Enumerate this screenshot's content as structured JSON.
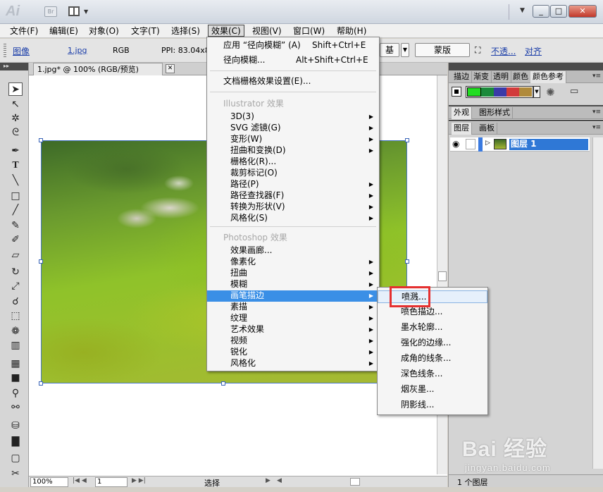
{
  "app": {
    "logo": "Ai",
    "bridge": "Br"
  },
  "window": {
    "min": "_",
    "max": "□",
    "close": "✕"
  },
  "menubar": [
    {
      "label": "文件(F)"
    },
    {
      "label": "编辑(E)"
    },
    {
      "label": "对象(O)"
    },
    {
      "label": "文字(T)"
    },
    {
      "label": "选择(S)"
    },
    {
      "label": "效果(C)"
    },
    {
      "label": "视图(V)"
    },
    {
      "label": "窗口(W)"
    },
    {
      "label": "帮助(H)"
    }
  ],
  "controlbar": {
    "image_label": "图像",
    "file_link": "1.jpg",
    "color_mode": "RGB",
    "ppi": "PPI: 83.04x84.",
    "partial_button": "基",
    "mask_button": "蒙版",
    "opacity_link": "不透...",
    "align_link": "对齐"
  },
  "document": {
    "tab_title": "1.jpg* @ 100% (RGB/预览)",
    "tab_close": "✕"
  },
  "statusbar": {
    "zoom": "100%",
    "page": "1",
    "tool": "选择"
  },
  "effects_menu": {
    "apply_last": {
      "label": "应用 “径向模糊” (A)",
      "shortcut": "Shift+Ctrl+E"
    },
    "last_effect": {
      "label": "径向模糊...",
      "shortcut": "Alt+Shift+Ctrl+E"
    },
    "raster_settings": "文档栅格效果设置(E)...",
    "illustrator_header": "Illustrator 效果",
    "illustrator_items": [
      {
        "label": "3D(3)",
        "sub": true
      },
      {
        "label": "SVG 滤镜(G)",
        "sub": true
      },
      {
        "label": "变形(W)",
        "sub": true
      },
      {
        "label": "扭曲和变换(D)",
        "sub": true
      },
      {
        "label": "栅格化(R)...",
        "sub": false
      },
      {
        "label": "裁剪标记(O)",
        "sub": false
      },
      {
        "label": "路径(P)",
        "sub": true
      },
      {
        "label": "路径查找器(F)",
        "sub": true
      },
      {
        "label": "转换为形状(V)",
        "sub": true
      },
      {
        "label": "风格化(S)",
        "sub": true
      }
    ],
    "photoshop_header": "Photoshop 效果",
    "photoshop_items": [
      {
        "label": "效果画廊...",
        "sub": false
      },
      {
        "label": "像素化",
        "sub": true
      },
      {
        "label": "扭曲",
        "sub": true
      },
      {
        "label": "模糊",
        "sub": true
      },
      {
        "label": "画笔描边",
        "sub": true
      },
      {
        "label": "素描",
        "sub": true
      },
      {
        "label": "纹理",
        "sub": true
      },
      {
        "label": "艺术效果",
        "sub": true
      },
      {
        "label": "视频",
        "sub": true
      },
      {
        "label": "锐化",
        "sub": true
      },
      {
        "label": "风格化",
        "sub": true
      }
    ]
  },
  "brush_submenu": [
    {
      "label": "喷溅..."
    },
    {
      "label": "喷色描边..."
    },
    {
      "label": "墨水轮廓..."
    },
    {
      "label": "强化的边缘..."
    },
    {
      "label": "成角的线条..."
    },
    {
      "label": "深色线条..."
    },
    {
      "label": "烟灰墨..."
    },
    {
      "label": "阴影线..."
    }
  ],
  "panels": {
    "top_tabs": [
      "描边",
      "渐变",
      "透明",
      "颜色",
      "颜色参考"
    ],
    "appearance_tabs": [
      "外观",
      "图形样式"
    ],
    "layers_tabs": [
      "图层",
      "画板"
    ],
    "layer_name": "图层 1",
    "footer": "1 个图层"
  },
  "swatches": [
    "#22dd22",
    "#1a8a3a",
    "#3a3aa8",
    "#d23a3a",
    "#b08a3a"
  ],
  "watermark": {
    "brand": "Bai 经验",
    "site": "jingyan.baidu.com"
  }
}
